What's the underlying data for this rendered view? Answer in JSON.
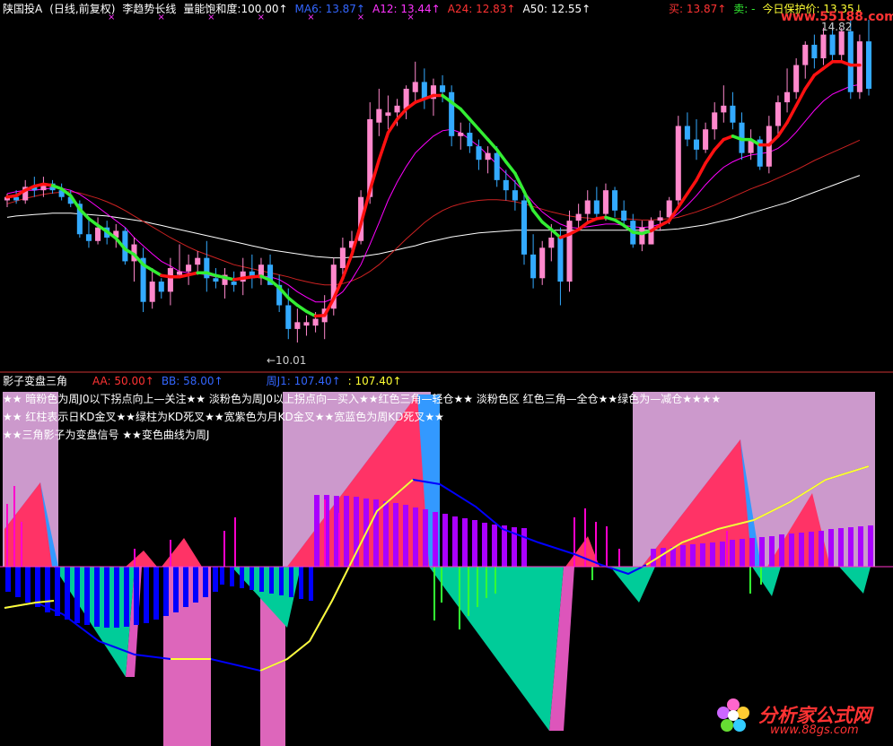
{
  "colors": {
    "bg": "#000000",
    "up": "#ff88cc",
    "down": "#33aaff",
    "doji": "#ffffff",
    "ma6": "#ff00ff",
    "ma12": "#ff3333",
    "ma24": "#ffffff",
    "ma50": "#ffffff",
    "trend_up": "#ff1111",
    "trend_down": "#33ee33",
    "band": "#cc99cc",
    "tri_red": "#ff3366",
    "tri_blue": "#3366ff",
    "tri_cyan": "#00cc99",
    "tri_pink": "#dd55bb",
    "tri_light_blue": "#3399ff",
    "pos_bar": "#ff00cc",
    "neg_bar": "#0000ff",
    "purple_bar": "#aa00ff",
    "green_bar": "#33ff33",
    "yellow_line": "#ffff33",
    "blue_line": "#0000ff",
    "divider": "#cc3333"
  },
  "header": {
    "title": "陕国投A",
    "period": "(日线,前复权)",
    "indicator": "李趋势长线",
    "saturation_label": "量能饱和度:",
    "saturation_value": "100.00↑",
    "ma6": "MA6: 13.87↑",
    "ma12": "A12: 13.44↑",
    "ma24": "A24: 12.83↑",
    "ma50": "A50: 12.55↑",
    "buy": "买: 13.87↑",
    "sell": "卖: -",
    "protect": "今日保护价: 13.35↓",
    "markers": "× × × ×  ×  × ×"
  },
  "watermark": {
    "top": "www.55188.com",
    "bottom_cn": "分析家公式网",
    "bottom_url": "www.88gs.com"
  },
  "top_chart": {
    "high_label": "14.82",
    "low_label": "←10.01",
    "candles": [
      [
        12.15,
        12.25,
        12.05,
        12.2
      ],
      [
        12.2,
        12.3,
        12.1,
        12.15
      ],
      [
        12.15,
        12.45,
        12.1,
        12.35
      ],
      [
        12.35,
        12.5,
        12.2,
        12.3
      ],
      [
        12.3,
        12.5,
        12.2,
        12.4
      ],
      [
        12.4,
        12.45,
        12.25,
        12.3
      ],
      [
        12.3,
        12.4,
        12.15,
        12.2
      ],
      [
        12.2,
        12.3,
        12.05,
        12.1
      ],
      [
        12.1,
        12.15,
        11.6,
        11.65
      ],
      [
        11.65,
        11.9,
        11.45,
        11.55
      ],
      [
        11.55,
        11.9,
        11.5,
        11.75
      ],
      [
        11.75,
        11.85,
        11.5,
        11.6
      ],
      [
        11.6,
        11.8,
        11.45,
        11.7
      ],
      [
        11.7,
        11.75,
        11.2,
        11.25
      ],
      [
        11.25,
        11.6,
        10.95,
        11.5
      ],
      [
        11.3,
        11.45,
        10.5,
        10.65
      ],
      [
        10.65,
        11.15,
        10.55,
        10.95
      ],
      [
        10.95,
        11.0,
        10.7,
        10.8
      ],
      [
        10.8,
        11.3,
        10.6,
        11.15
      ],
      [
        11.05,
        11.5,
        11.0,
        11.1
      ],
      [
        11.1,
        11.35,
        10.9,
        11.2
      ],
      [
        11.2,
        11.4,
        11.05,
        11.3
      ],
      [
        11.3,
        11.55,
        10.8,
        11.0
      ],
      [
        11.0,
        11.15,
        10.85,
        10.95
      ],
      [
        10.9,
        11.15,
        10.7,
        11.05
      ],
      [
        10.95,
        11.1,
        10.8,
        10.9
      ],
      [
        10.95,
        11.3,
        10.75,
        11.1
      ],
      [
        11.1,
        11.35,
        10.85,
        11.0
      ],
      [
        11.0,
        11.3,
        10.9,
        11.2
      ],
      [
        11.2,
        11.35,
        10.95,
        10.9
      ],
      [
        10.9,
        11.05,
        10.5,
        10.6
      ],
      [
        10.6,
        10.85,
        10.1,
        10.25
      ],
      [
        10.25,
        10.55,
        10.05,
        10.35
      ],
      [
        10.3,
        10.45,
        10.15,
        10.35
      ],
      [
        10.3,
        10.5,
        10.2,
        10.4
      ],
      [
        10.35,
        10.75,
        10.1,
        10.55
      ],
      [
        10.55,
        11.3,
        10.45,
        11.2
      ],
      [
        11.15,
        11.6,
        11.05,
        11.45
      ],
      [
        11.45,
        11.7,
        11.3,
        11.55
      ],
      [
        11.55,
        12.3,
        11.5,
        12.2
      ],
      [
        12.2,
        13.6,
        12.1,
        13.35
      ],
      [
        13.3,
        13.8,
        13.1,
        13.5
      ],
      [
        13.4,
        13.7,
        13.2,
        13.45
      ],
      [
        13.45,
        13.65,
        13.25,
        13.55
      ],
      [
        13.5,
        13.85,
        13.35,
        13.8
      ],
      [
        13.75,
        14.2,
        13.6,
        13.9
      ],
      [
        13.9,
        14.1,
        13.5,
        13.65
      ],
      [
        13.65,
        13.95,
        13.4,
        13.85
      ],
      [
        13.85,
        14.0,
        13.6,
        13.75
      ],
      [
        13.75,
        13.85,
        12.95,
        13.1
      ],
      [
        13.1,
        13.3,
        12.9,
        13.15
      ],
      [
        13.15,
        13.3,
        12.85,
        12.95
      ],
      [
        12.95,
        13.05,
        12.6,
        12.75
      ],
      [
        12.75,
        12.95,
        12.55,
        12.85
      ],
      [
        12.85,
        12.95,
        12.35,
        12.45
      ],
      [
        12.45,
        12.6,
        12.15,
        12.3
      ],
      [
        12.3,
        12.45,
        12.0,
        12.15
      ],
      [
        12.15,
        12.25,
        11.2,
        11.35
      ],
      [
        11.35,
        11.65,
        10.85,
        11.0
      ],
      [
        11.0,
        11.55,
        10.9,
        11.45
      ],
      [
        11.45,
        11.8,
        11.25,
        11.6
      ],
      [
        11.6,
        11.75,
        10.6,
        10.95
      ],
      [
        10.95,
        12.0,
        10.8,
        11.85
      ],
      [
        11.85,
        12.1,
        11.7,
        11.95
      ],
      [
        11.95,
        12.3,
        11.8,
        12.15
      ],
      [
        12.15,
        12.35,
        11.9,
        11.95
      ],
      [
        11.95,
        12.4,
        11.85,
        12.3
      ],
      [
        12.3,
        12.35,
        11.9,
        12.0
      ],
      [
        12.0,
        12.15,
        11.75,
        11.85
      ],
      [
        11.85,
        11.95,
        11.45,
        11.5
      ],
      [
        11.5,
        11.85,
        11.4,
        11.75
      ],
      [
        11.5,
        11.9,
        11.5,
        11.85
      ],
      [
        11.85,
        12.0,
        11.7,
        11.9
      ],
      [
        11.9,
        12.2,
        11.8,
        12.15
      ],
      [
        12.15,
        13.4,
        12.05,
        13.25
      ],
      [
        13.25,
        13.45,
        12.95,
        13.05
      ],
      [
        13.05,
        13.35,
        12.75,
        12.9
      ],
      [
        12.9,
        13.3,
        12.85,
        13.2
      ],
      [
        13.2,
        13.6,
        13.05,
        13.45
      ],
      [
        13.45,
        13.85,
        13.3,
        13.55
      ],
      [
        13.55,
        13.75,
        13.2,
        13.3
      ],
      [
        13.3,
        13.45,
        12.75,
        12.85
      ],
      [
        12.85,
        13.2,
        12.75,
        13.05
      ],
      [
        13.05,
        13.1,
        12.6,
        12.65
      ],
      [
        12.65,
        13.4,
        12.55,
        13.25
      ],
      [
        13.25,
        13.7,
        13.1,
        13.6
      ],
      [
        13.6,
        14.1,
        13.45,
        13.75
      ],
      [
        13.75,
        14.25,
        13.65,
        14.15
      ],
      [
        14.15,
        14.5,
        13.95,
        14.45
      ],
      [
        14.45,
        14.6,
        14.1,
        14.25
      ],
      [
        14.25,
        14.7,
        14.15,
        14.6
      ],
      [
        14.6,
        14.75,
        14.2,
        14.3
      ],
      [
        14.3,
        14.7,
        14.2,
        14.65
      ],
      [
        14.65,
        14.82,
        13.65,
        13.75
      ],
      [
        13.75,
        14.6,
        13.65,
        14.5
      ],
      [
        14.5,
        14.82,
        13.7,
        13.8
      ]
    ],
    "trend": [
      12.2,
      12.22,
      12.3,
      12.36,
      12.39,
      12.37,
      12.32,
      12.22,
      12.02,
      11.88,
      11.78,
      11.69,
      11.59,
      11.43,
      11.35,
      11.2,
      11.12,
      11.04,
      11.02,
      11.02,
      11.05,
      11.08,
      11.08,
      11.04,
      11.01,
      10.98,
      11.0,
      11.02,
      11.03,
      10.97,
      10.86,
      10.71,
      10.6,
      10.51,
      10.44,
      10.45,
      10.7,
      11.0,
      11.35,
      11.8,
      12.3,
      12.75,
      13.15,
      13.35,
      13.5,
      13.6,
      13.65,
      13.7,
      13.7,
      13.6,
      13.5,
      13.35,
      13.2,
      13.05,
      12.9,
      12.72,
      12.55,
      12.28,
      12.0,
      11.83,
      11.72,
      11.6,
      11.65,
      11.72,
      11.82,
      11.88,
      11.9,
      11.86,
      11.78,
      11.68,
      11.66,
      11.7,
      11.78,
      11.85,
      12.05,
      12.25,
      12.45,
      12.7,
      12.9,
      13.05,
      13.1,
      13.05,
      13.05,
      12.97,
      12.97,
      13.1,
      13.3,
      13.55,
      13.8,
      14.0,
      14.1,
      14.2,
      14.2,
      14.15,
      14.15
    ],
    "trend_up_flags": [
      1,
      1,
      1,
      1,
      1,
      1,
      0,
      0,
      0,
      0,
      0,
      0,
      0,
      0,
      0,
      0,
      0,
      0,
      1,
      1,
      1,
      1,
      0,
      0,
      0,
      0,
      1,
      1,
      1,
      0,
      0,
      0,
      0,
      0,
      0,
      1,
      1,
      1,
      1,
      1,
      1,
      1,
      1,
      1,
      1,
      1,
      1,
      1,
      1,
      0,
      0,
      0,
      0,
      0,
      0,
      0,
      0,
      0,
      0,
      0,
      0,
      0,
      1,
      1,
      1,
      1,
      1,
      0,
      0,
      0,
      0,
      0,
      1,
      1,
      1,
      1,
      1,
      1,
      1,
      1,
      1,
      0,
      0,
      0,
      1,
      1,
      1,
      1,
      1,
      1,
      1,
      1,
      1,
      1,
      1
    ],
    "ma_purple": [
      12.25,
      12.28,
      12.3,
      12.3,
      12.32,
      12.33,
      12.33,
      12.3,
      12.24,
      12.15,
      12.05,
      11.95,
      11.85,
      11.75,
      11.6,
      11.48,
      11.36,
      11.25,
      11.18,
      11.1,
      11.08,
      11.07,
      11.05,
      11.02,
      11.0,
      10.99,
      11.0,
      11.02,
      11.03,
      11.02,
      10.98,
      10.9,
      10.8,
      10.72,
      10.65,
      10.65,
      10.7,
      10.8,
      10.98,
      11.2,
      11.5,
      11.82,
      12.15,
      12.42,
      12.65,
      12.85,
      12.98,
      13.1,
      13.18,
      13.2,
      13.15,
      13.05,
      12.95,
      12.82,
      12.68,
      12.55,
      12.42,
      12.28,
      12.12,
      11.98,
      11.88,
      11.8,
      11.75,
      11.74,
      11.76,
      11.78,
      11.8,
      11.8,
      11.78,
      11.76,
      11.75,
      11.76,
      11.8,
      11.86,
      11.96,
      12.08,
      12.22,
      12.38,
      12.52,
      12.64,
      12.72,
      12.78,
      12.82,
      12.84,
      12.86,
      12.92,
      13.02,
      13.16,
      13.32,
      13.48,
      13.62,
      13.72,
      13.78,
      13.84,
      13.86
    ],
    "ma_red": [
      12.1,
      12.14,
      12.18,
      12.21,
      12.24,
      12.26,
      12.27,
      12.28,
      12.26,
      12.22,
      12.18,
      12.13,
      12.07,
      12.0,
      11.92,
      11.84,
      11.76,
      11.68,
      11.6,
      11.53,
      11.46,
      11.4,
      11.35,
      11.3,
      11.25,
      11.2,
      11.17,
      11.14,
      11.11,
      11.08,
      11.05,
      11.02,
      10.98,
      10.95,
      10.92,
      10.9,
      10.9,
      10.92,
      10.96,
      11.02,
      11.1,
      11.2,
      11.32,
      11.45,
      11.58,
      11.7,
      11.82,
      11.92,
      12.0,
      12.06,
      12.1,
      12.13,
      12.15,
      12.16,
      12.16,
      12.15,
      12.13,
      12.1,
      12.06,
      12.02,
      11.98,
      11.95,
      11.92,
      11.9,
      11.89,
      11.88,
      11.88,
      11.88,
      11.88,
      11.87,
      11.86,
      11.86,
      11.87,
      11.88,
      11.9,
      11.94,
      11.98,
      12.03,
      12.08,
      12.14,
      12.2,
      12.26,
      12.32,
      12.37,
      12.42,
      12.48,
      12.54,
      12.6,
      12.67,
      12.74,
      12.8,
      12.86,
      12.92,
      12.98,
      13.04
    ],
    "ma_white": [
      11.9,
      11.92,
      11.93,
      11.94,
      11.95,
      11.96,
      11.96,
      11.96,
      11.95,
      11.94,
      11.93,
      11.92,
      11.9,
      11.88,
      11.86,
      11.84,
      11.81,
      11.78,
      11.75,
      11.72,
      11.69,
      11.66,
      11.63,
      11.6,
      11.57,
      11.54,
      11.51,
      11.48,
      11.45,
      11.42,
      11.4,
      11.38,
      11.36,
      11.34,
      11.32,
      11.31,
      11.3,
      11.3,
      11.31,
      11.32,
      11.34,
      11.36,
      11.39,
      11.42,
      11.45,
      11.48,
      11.52,
      11.55,
      11.58,
      11.61,
      11.63,
      11.65,
      11.67,
      11.68,
      11.69,
      11.7,
      11.71,
      11.71,
      11.71,
      11.71,
      11.71,
      11.71,
      11.71,
      11.71,
      11.71,
      11.71,
      11.71,
      11.71,
      11.71,
      11.71,
      11.71,
      11.71,
      11.71,
      11.72,
      11.73,
      11.75,
      11.77,
      11.79,
      11.82,
      11.85,
      11.88,
      11.92,
      11.96,
      12.0,
      12.04,
      12.08,
      12.12,
      12.17,
      12.22,
      12.27,
      12.32,
      12.37,
      12.42,
      12.47,
      12.52
    ]
  },
  "bottom_chart": {
    "title": "影子变盘三角",
    "aa": "AA: 50.00↑",
    "bb": "BB: 58.00↑",
    "zhou": "周J1: 107.40↑",
    "val": ": 107.40↑",
    "notes": [
      "★★ 暗粉色为周J0以下拐点向上—关注★★ 淡粉色为周J0以上拐点向—买入★★红色三角—轻仓★★ 淡粉色区 红色三角—全仓★★绿色为—减仓★★★★",
      "★★ 红柱表示日KD金叉★★绿柱为KD死叉★★宽紫色为月KD金叉★★宽蓝色为周KD死叉★★",
      "★★三角影子为变盘信号 ★★变色曲线为周J"
    ]
  }
}
